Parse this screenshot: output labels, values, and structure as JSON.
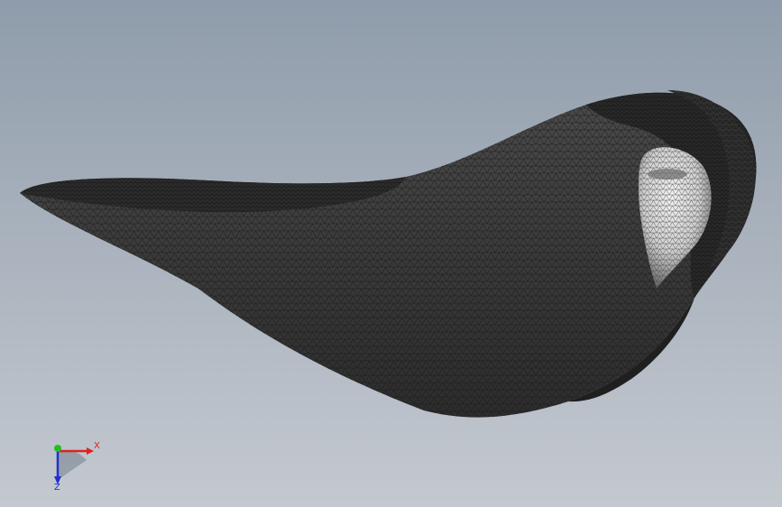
{
  "viewport": {
    "background_top": "#8f9cab",
    "background_bottom": "#c4c9d0"
  },
  "model": {
    "render_mode": "wireframe-mesh",
    "mesh_color": "#2a2a2a",
    "body_color": "#3b3b3b",
    "highlight_color": "#e6e6e6"
  },
  "triad": {
    "x_label": "X",
    "z_label": "Z",
    "x_color": "#e02020",
    "y_color": "#20c020",
    "z_color": "#2030d0"
  }
}
